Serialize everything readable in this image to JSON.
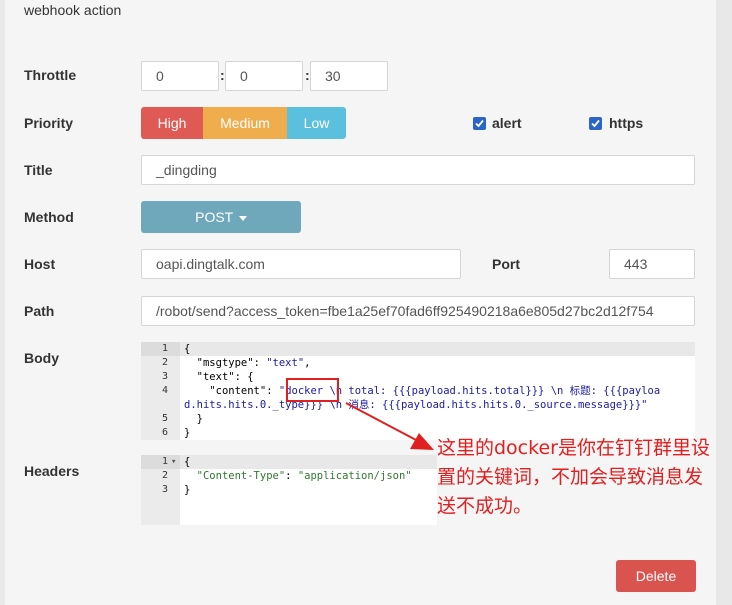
{
  "section": {
    "title": "webhook action"
  },
  "throttle": {
    "label": "Throttle",
    "h": "0",
    "m": "0",
    "s": "30",
    "sep": ":"
  },
  "priority": {
    "label": "Priority",
    "high": "High",
    "medium": "Medium",
    "low": "Low",
    "accent_high": "#e05a55",
    "accent_medium": "#f0ad4e",
    "accent_low": "#5bc0de"
  },
  "alert": {
    "label": "alert",
    "checked": true
  },
  "https": {
    "label": "https",
    "checked": true
  },
  "title": {
    "label": "Title",
    "value": "_dingding"
  },
  "method": {
    "label": "Method",
    "value": "POST"
  },
  "host": {
    "label": "Host",
    "value": "oapi.dingtalk.com"
  },
  "port": {
    "label": "Port",
    "value": "443"
  },
  "path": {
    "label": "Path",
    "value": "/robot/send?access_token=fbe1a25ef70fad6ff925490218a6e805d27bc2d12f754"
  },
  "body": {
    "label": "Body",
    "line_numbers": [
      "1",
      "2",
      "3",
      "4",
      "",
      "5",
      "6"
    ],
    "l1": "{",
    "l2_key": "\"msgtype\"",
    "l2_sep": ": ",
    "l2_val": "\"text\"",
    "l2_end": ",",
    "l3_key": "\"text\"",
    "l3_end": ": {",
    "l4_key": "\"content\"",
    "l4_sep": ": ",
    "l4_a": "\"",
    "l4_b": "docker",
    "l4_c": " \\n total: {{{payload.hits.total}}} \\n 标题: {{{payloa",
    "l4w": "d.hits.hits.0._type}}} \\n 消息: {{{payload.hits.hits.0._source.message}}}\"",
    "l5": "}",
    "l6": "}"
  },
  "headers": {
    "label": "Headers",
    "line_numbers": [
      "1",
      "2",
      "3"
    ],
    "fold": "▾",
    "l1": "{",
    "l2_key": "\"Content-Type\"",
    "l2_sep": ": ",
    "l2_val": "\"application/json\"",
    "l3": "}"
  },
  "annotation": {
    "text": "这里的docker是你在钉钉群里设置的关键词，不加会导致消息发送不成功。"
  },
  "delete": {
    "label": "Delete"
  }
}
